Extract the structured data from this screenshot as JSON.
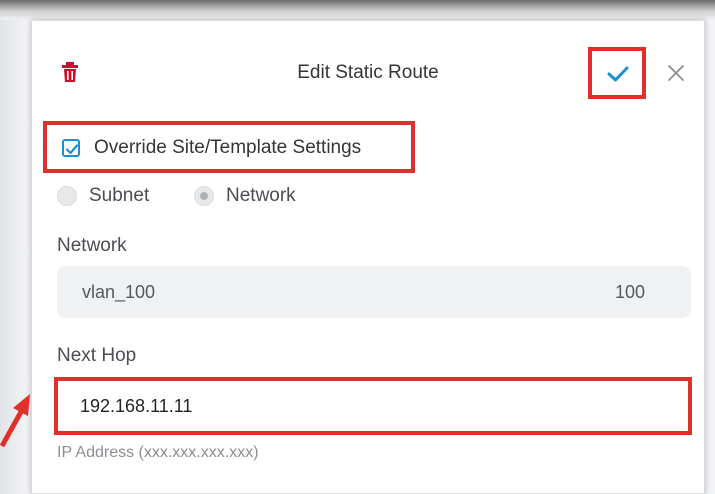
{
  "dialog": {
    "title": "Edit Static Route",
    "icons": {
      "delete": "trash-icon",
      "confirm": "check-icon",
      "close": "close-icon"
    }
  },
  "override": {
    "label": "Override Site/Template Settings",
    "checked": true
  },
  "destination_type": {
    "options": [
      "Subnet",
      "Network"
    ],
    "selected": "Network"
  },
  "network": {
    "label": "Network",
    "value": "vlan_100",
    "vlan_id": "100"
  },
  "next_hop": {
    "label": "Next Hop",
    "value": "192.168.11.11",
    "hint": "IP Address (xxx.xxx.xxx.xxx)"
  },
  "colors": {
    "accent": "#1a8fd6",
    "highlight": "#e0302a",
    "delete": "#c8102e"
  }
}
